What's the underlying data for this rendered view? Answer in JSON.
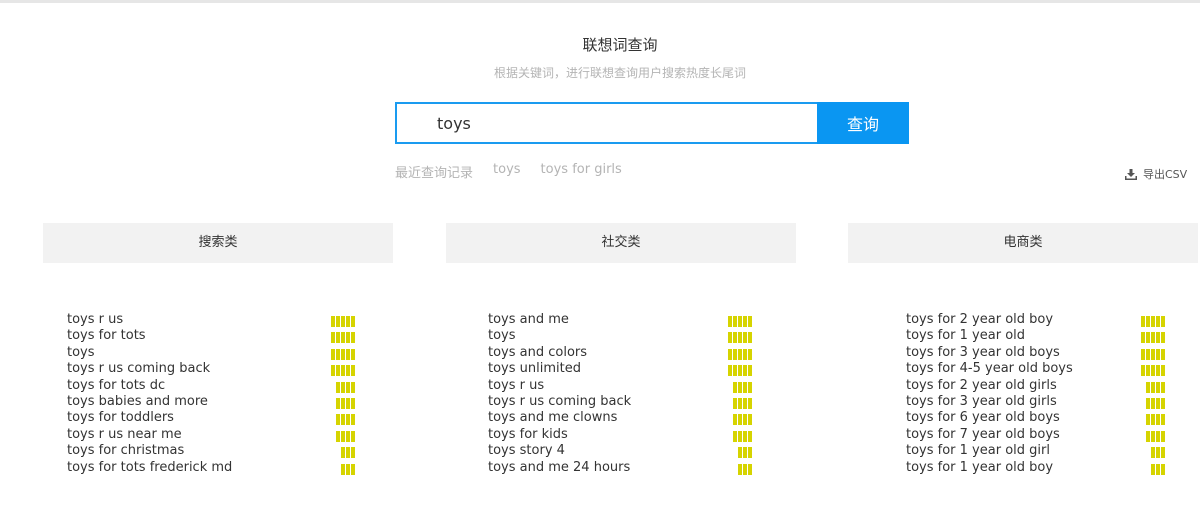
{
  "header": {
    "title": "联想词查询",
    "subtitle": "根据关键词，进行联想查询用户搜索热度长尾词"
  },
  "search": {
    "value": "toys",
    "button_label": "查询"
  },
  "history": {
    "label": "最近查询记录",
    "items": [
      "toys",
      "toys for girls"
    ]
  },
  "export": {
    "label": "导出CSV",
    "icon": "download-icon"
  },
  "colors": {
    "accent": "#0a96f2",
    "heat_bar": "#d6d400",
    "header_bg": "#f2f2f2"
  },
  "columns": [
    {
      "title": "搜索类",
      "rows": [
        {
          "keyword": "toys r us",
          "heat": 5
        },
        {
          "keyword": "toys for tots",
          "heat": 5
        },
        {
          "keyword": "toys",
          "heat": 5
        },
        {
          "keyword": "toys r us coming back",
          "heat": 5
        },
        {
          "keyword": "toys for tots dc",
          "heat": 4
        },
        {
          "keyword": "toys babies and more",
          "heat": 4
        },
        {
          "keyword": "toys for toddlers",
          "heat": 4
        },
        {
          "keyword": "toys r us near me",
          "heat": 4
        },
        {
          "keyword": "toys for christmas",
          "heat": 3
        },
        {
          "keyword": "toys for tots frederick md",
          "heat": 3
        }
      ]
    },
    {
      "title": "社交类",
      "rows": [
        {
          "keyword": "toys and me",
          "heat": 5
        },
        {
          "keyword": "toys",
          "heat": 5
        },
        {
          "keyword": "toys and colors",
          "heat": 5
        },
        {
          "keyword": "toys unlimited",
          "heat": 5
        },
        {
          "keyword": "toys r us",
          "heat": 4
        },
        {
          "keyword": "toys r us coming back",
          "heat": 4
        },
        {
          "keyword": "toys and me clowns",
          "heat": 4
        },
        {
          "keyword": "toys for kids",
          "heat": 4
        },
        {
          "keyword": "toys story 4",
          "heat": 3
        },
        {
          "keyword": "toys and me 24 hours",
          "heat": 3
        }
      ]
    },
    {
      "title": "电商类",
      "rows": [
        {
          "keyword": "toys for 2 year old boy",
          "heat": 5
        },
        {
          "keyword": "toys for 1 year old",
          "heat": 5
        },
        {
          "keyword": "toys for 3 year old boys",
          "heat": 5
        },
        {
          "keyword": "toys for 4-5 year old boys",
          "heat": 5
        },
        {
          "keyword": "toys for 2 year old girls",
          "heat": 4
        },
        {
          "keyword": "toys for 3 year old girls",
          "heat": 4
        },
        {
          "keyword": "toys for 6 year old boys",
          "heat": 4
        },
        {
          "keyword": "toys for 7 year old boys",
          "heat": 4
        },
        {
          "keyword": "toys for 1 year old girl",
          "heat": 3
        },
        {
          "keyword": "toys for 1 year old boy",
          "heat": 3
        }
      ]
    }
  ]
}
